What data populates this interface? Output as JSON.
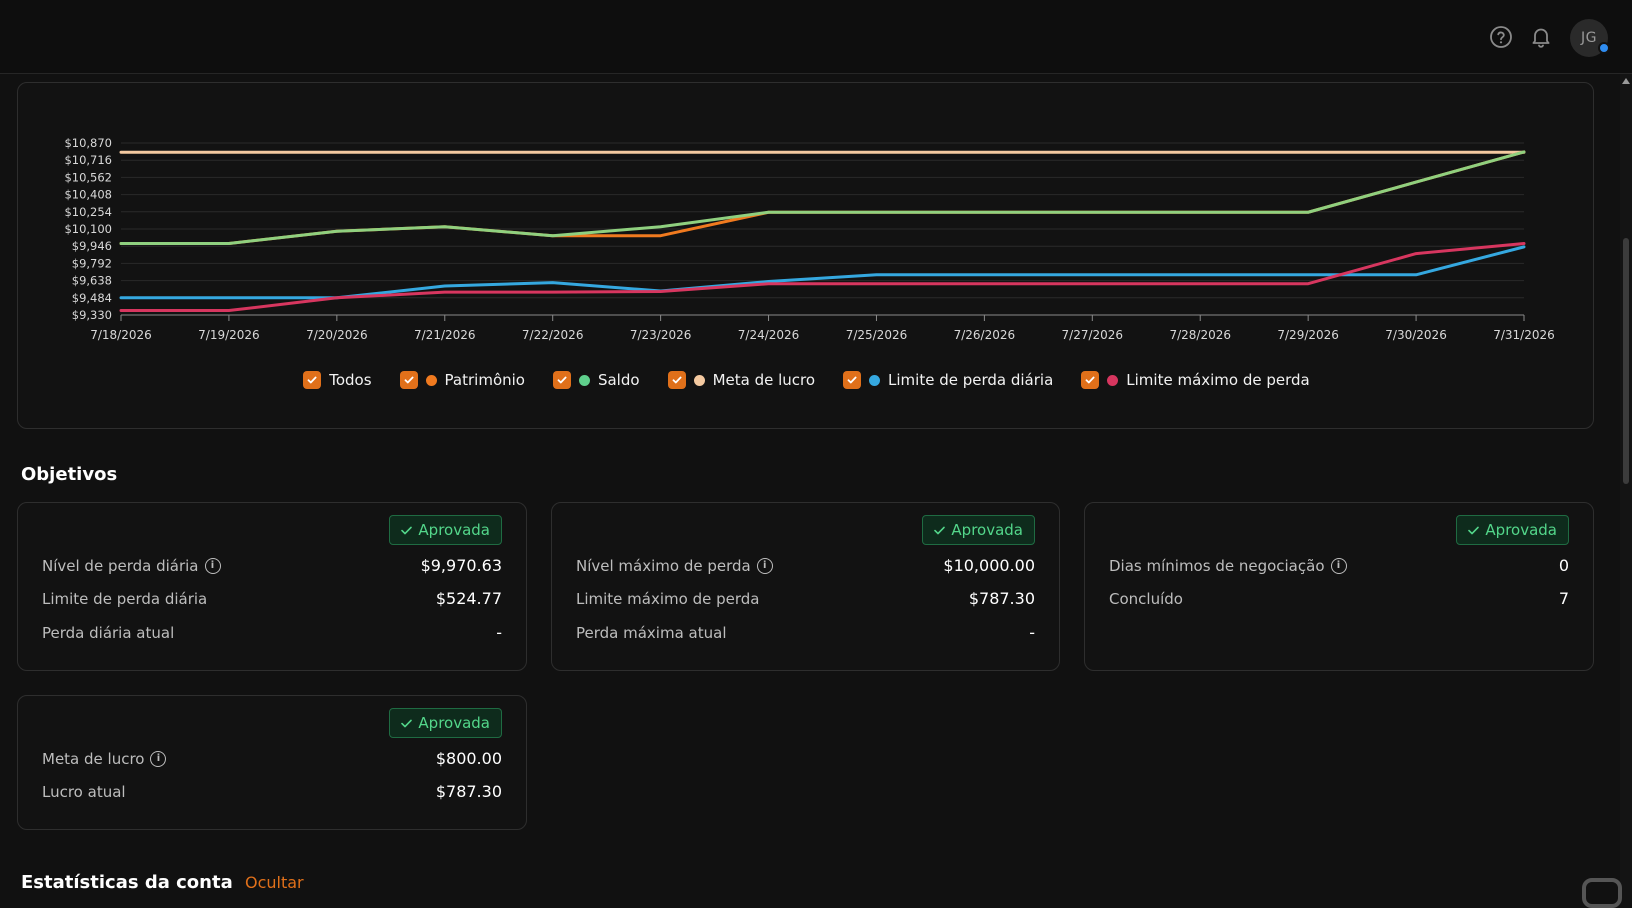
{
  "header": {
    "help_icon": "help-circle-icon",
    "bell_icon": "bell-icon",
    "avatar_initials": "JG"
  },
  "chart_data": {
    "type": "line",
    "x": [
      "7/18/2026",
      "7/19/2026",
      "7/20/2026",
      "7/21/2026",
      "7/22/2026",
      "7/23/2026",
      "7/24/2026",
      "7/25/2026",
      "7/26/2026",
      "7/27/2026",
      "7/28/2026",
      "7/29/2026",
      "7/30/2026",
      "7/31/2026"
    ],
    "yticks": [
      "$10,870",
      "$10,716",
      "$10,562",
      "$10,408",
      "$10,254",
      "$10,100",
      "$9,946",
      "$9,792",
      "$9,638",
      "$9,484",
      "$9,330"
    ],
    "ylim": [
      9330,
      10870
    ],
    "grid": true,
    "series": [
      {
        "name": "Patrimônio",
        "color": "#f07a1f",
        "values": [
          9970,
          9970,
          10080,
          10120,
          10040,
          10040,
          10250,
          10250,
          10250,
          10250,
          10250,
          10250,
          10520,
          10790
        ]
      },
      {
        "name": "Saldo",
        "color": "#8fd07f",
        "values": [
          9970,
          9970,
          10080,
          10120,
          10040,
          10120,
          10250,
          10250,
          10250,
          10250,
          10250,
          10250,
          10520,
          10790
        ]
      },
      {
        "name": "Meta de lucro",
        "color": "#f4c9a0",
        "values": [
          10787,
          10787,
          10787,
          10787,
          10787,
          10787,
          10787,
          10787,
          10787,
          10787,
          10787,
          10787,
          10787,
          10787
        ]
      },
      {
        "name": "Limite de perda diária",
        "color": "#35a8e0",
        "values": [
          9484,
          9484,
          9484,
          9590,
          9620,
          9545,
          9630,
          9690,
          9690,
          9690,
          9690,
          9690,
          9690,
          9940
        ]
      },
      {
        "name": "Limite máximo de perda",
        "color": "#d7365f",
        "values": [
          9370,
          9370,
          9484,
          9535,
          9535,
          9540,
          9610,
          9610,
          9610,
          9610,
          9610,
          9610,
          9880,
          9970
        ]
      }
    ]
  },
  "legend": {
    "all_label": "Todos",
    "items": [
      {
        "label": "Patrimônio",
        "color": "#f07a1f"
      },
      {
        "label": "Saldo",
        "color": "#5fd08c"
      },
      {
        "label": "Meta de lucro",
        "color": "#f4c9a0"
      },
      {
        "label": "Limite de perda diária",
        "color": "#35a8e0"
      },
      {
        "label": "Limite máximo de perda",
        "color": "#d7365f"
      }
    ]
  },
  "objectives": {
    "title": "Objetivos",
    "badge": "Aprovada",
    "daily": {
      "level_label": "Nível de perda diária",
      "level_value": "$9,970.63",
      "limit_label": "Limite de perda diária",
      "limit_value": "$524.77",
      "current_label": "Perda diária atual",
      "current_value": "-"
    },
    "max": {
      "level_label": "Nível máximo de perda",
      "level_value": "$10,000.00",
      "limit_label": "Limite máximo de perda",
      "limit_value": "$787.30",
      "current_label": "Perda máxima atual",
      "current_value": "-"
    },
    "days": {
      "min_label": "Dias mínimos de negociação",
      "min_value": "0",
      "done_label": "Concluído",
      "done_value": "7"
    },
    "profit": {
      "target_label": "Meta de lucro",
      "target_value": "$800.00",
      "current_label": "Lucro atual",
      "current_value": "$787.30"
    }
  },
  "stats": {
    "title": "Estatísticas da conta",
    "hide_label": "Ocultar"
  }
}
